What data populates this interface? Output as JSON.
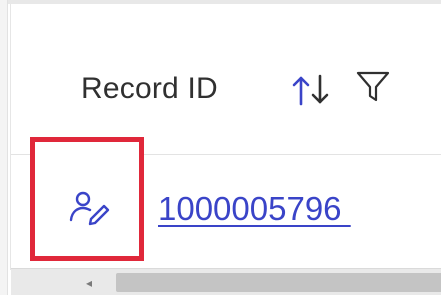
{
  "table": {
    "columns": [
      {
        "label": "Record ID",
        "sort_icon": "sort-up-down-icon",
        "filter_icon": "filter-funnel-icon"
      }
    ],
    "rows": [
      {
        "action_icon": "assign-user-edit-icon",
        "record_id": "1000005796 "
      }
    ]
  },
  "colors": {
    "link": "#3a44c8",
    "icon_accent": "#3a44c8",
    "highlight_border": "#e0283a",
    "header_text": "#303030"
  },
  "scrollbar": {
    "left_arrow_icon": "chevron-left-icon"
  }
}
